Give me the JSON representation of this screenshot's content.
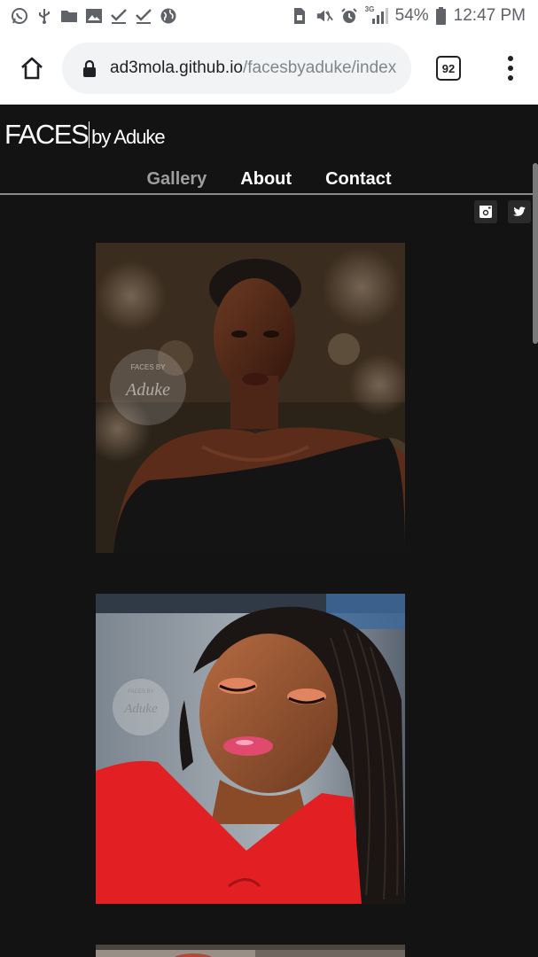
{
  "status_bar": {
    "left_icons": [
      "whatsapp-icon",
      "usb-icon",
      "folder-icon",
      "image-icon",
      "check-icon",
      "check-icon",
      "globe-icon"
    ],
    "right_icons": [
      "sim-icon",
      "mute-icon",
      "alarm-icon",
      "signal-icon"
    ],
    "network_label": "3G",
    "battery_percent": "54%",
    "time": "12:47 PM"
  },
  "browser": {
    "url_host": "ad3mola.github.io",
    "url_path": "/facesbyaduke/index",
    "tab_count": "92"
  },
  "site": {
    "logo_main": "FACES",
    "logo_sub": "by Aduke",
    "nav": [
      {
        "label": "Gallery",
        "active": true
      },
      {
        "label": "About",
        "active": false
      },
      {
        "label": "Contact",
        "active": false
      }
    ],
    "social": [
      "instagram-icon",
      "twitter-icon"
    ],
    "watermark_top": "FACES BY",
    "watermark_script": "Aduke"
  },
  "colors": {
    "page_background": "#131313",
    "nav_active": "#9e9e9e",
    "nav_text": "#ffffff",
    "omnibox": "#f1f3f4"
  }
}
